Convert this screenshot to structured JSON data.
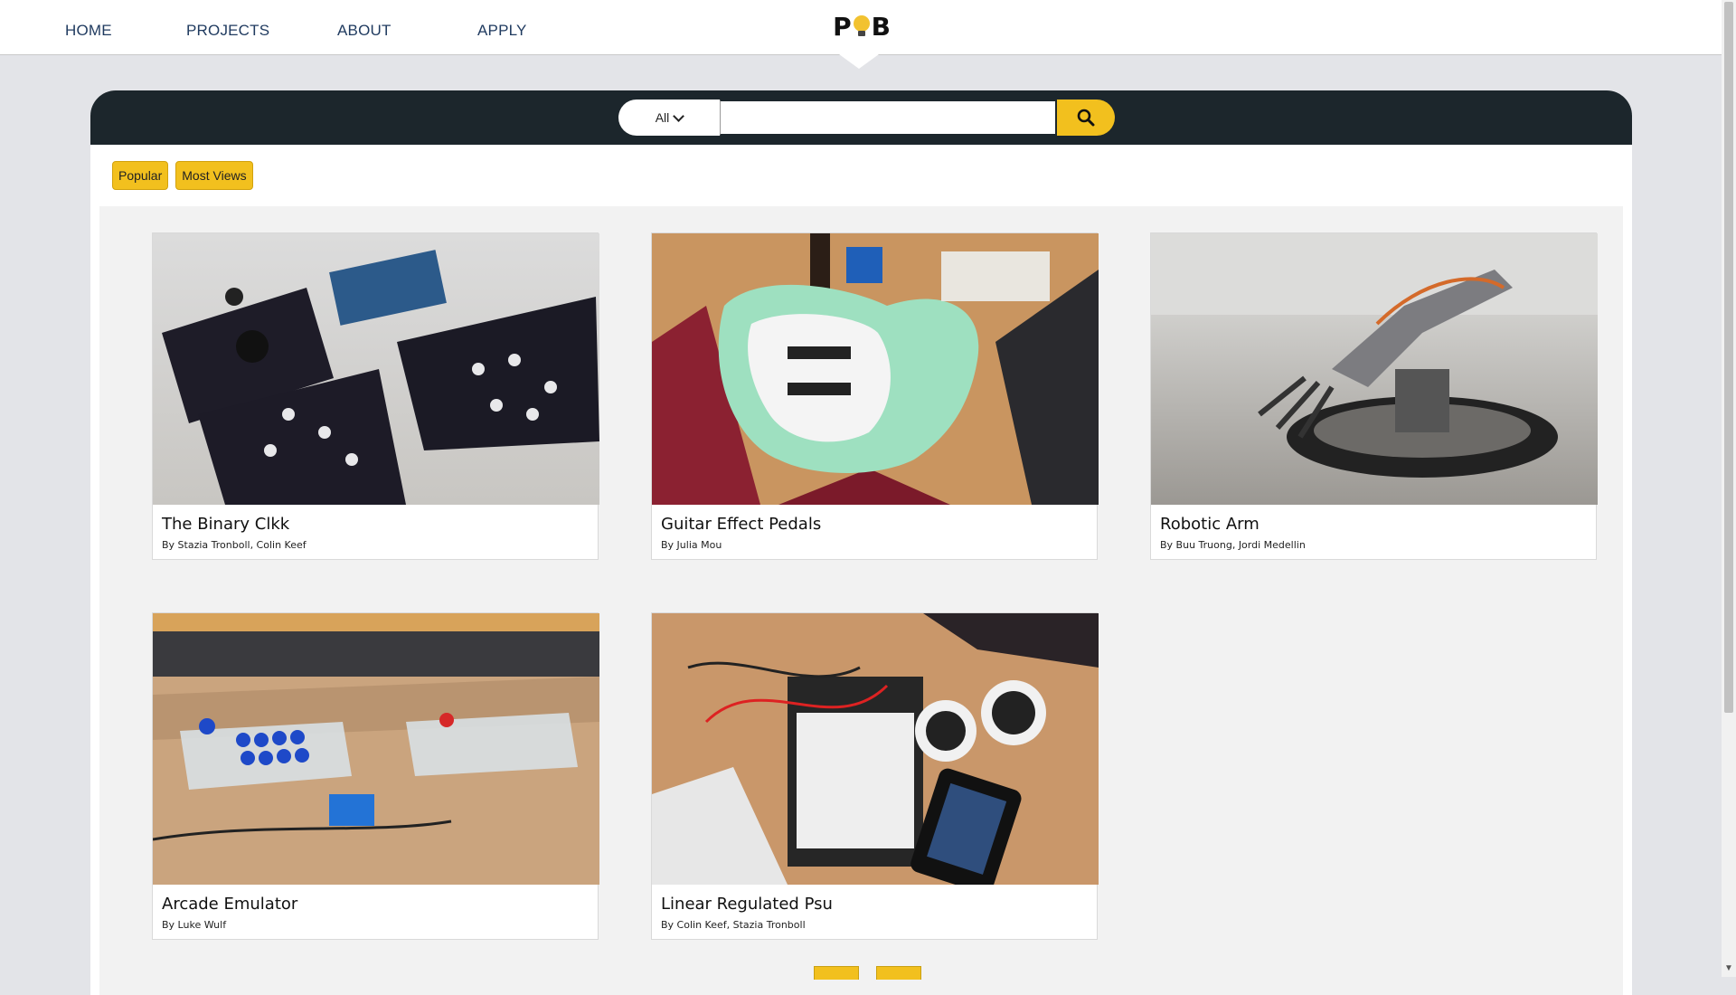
{
  "nav": {
    "links": [
      "HOME",
      "PROJECTS",
      "ABOUT",
      "APPLY"
    ],
    "logo": {
      "left": "P",
      "right": "B"
    }
  },
  "search": {
    "category_selected": "All",
    "query_value": "",
    "placeholder": ""
  },
  "filters": [
    "Popular",
    "Most Views"
  ],
  "projects": [
    {
      "title": "The Binary Clkk",
      "authors": "By Stazia Tronboll, Colin Keef"
    },
    {
      "title": "Guitar Effect Pedals",
      "authors": "By Julia Mou"
    },
    {
      "title": "Robotic Arm",
      "authors": "By Buu Truong, Jordi Medellin"
    },
    {
      "title": "Arcade Emulator",
      "authors": "By Luke Wulf"
    },
    {
      "title": "Linear Regulated Psu",
      "authors": "By Colin Keef, Stazia Tronboll"
    }
  ],
  "colors": {
    "accent": "#f2c01e",
    "band": "#1c262c",
    "page_bg": "#e3e4e8",
    "nav_text": "#1f3a5f"
  },
  "icons": [
    "search-icon",
    "chevron-down-icon",
    "lightbulb-icon"
  ]
}
